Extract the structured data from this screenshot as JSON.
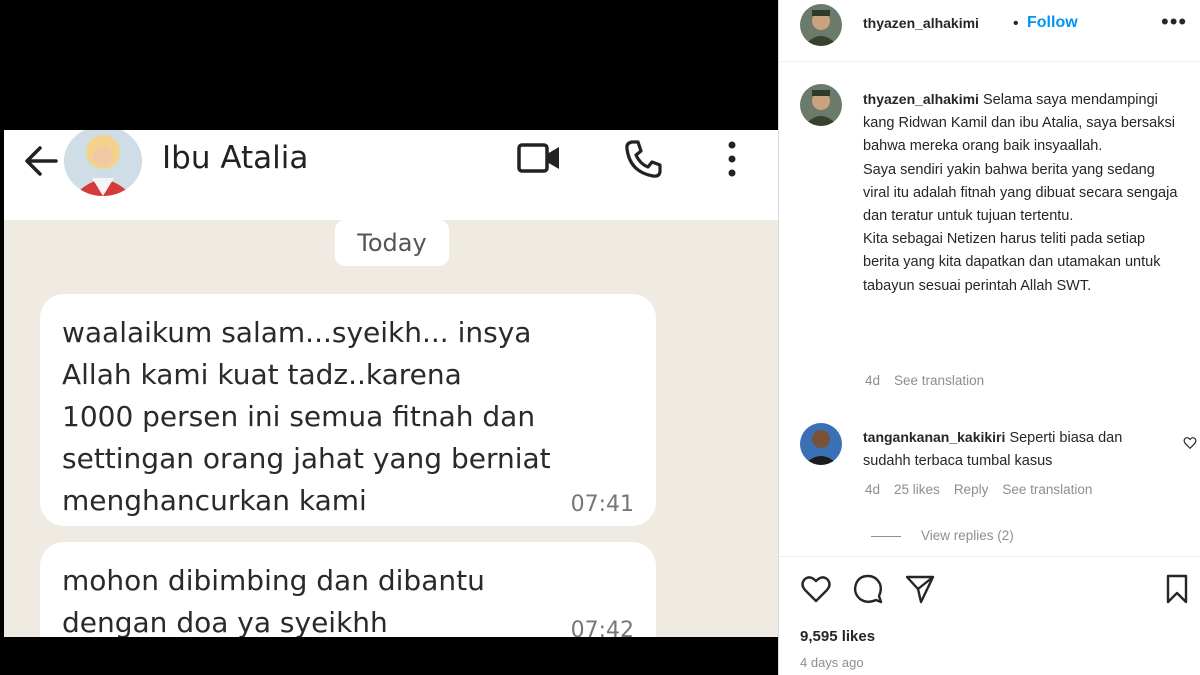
{
  "chat": {
    "contact_name": "Ibu Atalia",
    "date_label": "Today",
    "messages": [
      {
        "text": "waalaikum salam...syeikh... insya\nAllah kami kuat tadz..karena\n1000 persen ini semua fitnah dan\nsettingan orang jahat yang berniat\nmenghancurkan kami",
        "time": "07:41"
      },
      {
        "text": "mohon dibimbing dan dibantu\ndengan doa ya syeikhh",
        "time": "07:42"
      }
    ]
  },
  "post": {
    "author": "thyazen_alhakimi",
    "separator": "•",
    "follow_label": "Follow",
    "more_label": "•••",
    "caption_user": "thyazen_alhakimi",
    "caption_text": "Selama saya mendampingi kang Ridwan Kamil dan ibu Atalia, saya bersaksi bahwa mereka orang baik insyaallah.\nSaya sendiri yakin bahwa berita yang sedang viral itu adalah fitnah yang dibuat secara sengaja dan teratur untuk tujuan tertentu.\nKita sebagai Netizen harus teliti pada setiap berita yang kita dapatkan dan utamakan untuk tabayun sesuai perintah Allah SWT.",
    "caption_age": "4d",
    "caption_translate": "See translation",
    "comment": {
      "user": "tangankanan_kakikiri",
      "text": "Seperti biasa dan sudahh terbaca tumbal kasus",
      "age": "4d",
      "likes": "25 likes",
      "reply": "Reply",
      "translate": "See translation"
    },
    "view_replies": "View replies (2)",
    "likes_count": "9,595 likes",
    "posted_ago": "4 days ago"
  },
  "icons": {
    "back": "arrow-left-icon",
    "video": "video-call-icon",
    "phone": "phone-icon",
    "menu": "kebab-menu-icon",
    "heart": "heart-icon",
    "comment": "comment-icon",
    "share": "share-icon",
    "bookmark": "bookmark-icon"
  },
  "colors": {
    "follow_blue": "#0095f6",
    "chat_background": "#efeae2",
    "text_dark": "#262626",
    "text_muted": "#8e8e8e"
  }
}
